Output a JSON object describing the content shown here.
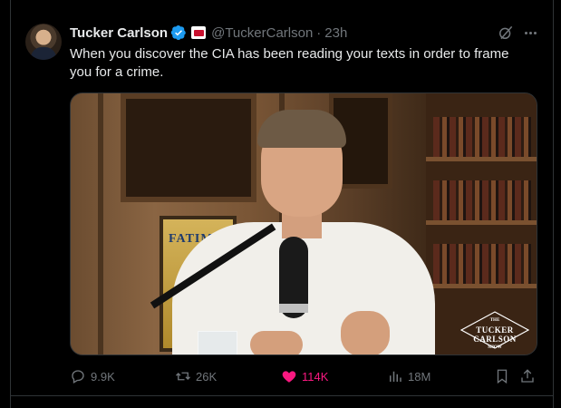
{
  "tweet": {
    "author_name": "Tucker Carlson",
    "handle": "@TuckerCarlson",
    "separator": "·",
    "time": "23h",
    "text": "When you discover the CIA has been reading your texts in order to frame you for a crime.",
    "media": {
      "poster_text": "FATIMA",
      "logo_lines": [
        "THE",
        "TUCKER",
        "CARLSON",
        "SHOW"
      ]
    }
  },
  "actions": {
    "replies": "9.9K",
    "reposts": "26K",
    "likes": "114K",
    "views": "18M"
  },
  "colors": {
    "background": "#000000",
    "text": "#e7e9ea",
    "muted": "#71767b",
    "like": "#f91880",
    "verified": "#1d9bf0",
    "affiliate": "#c8102e"
  },
  "icons": [
    "avatar",
    "verified-badge-icon",
    "affiliate-badge-icon",
    "grok-icon",
    "more-icon",
    "reply-icon",
    "repost-icon",
    "like-icon",
    "views-icon",
    "bookmark-icon",
    "share-icon"
  ]
}
